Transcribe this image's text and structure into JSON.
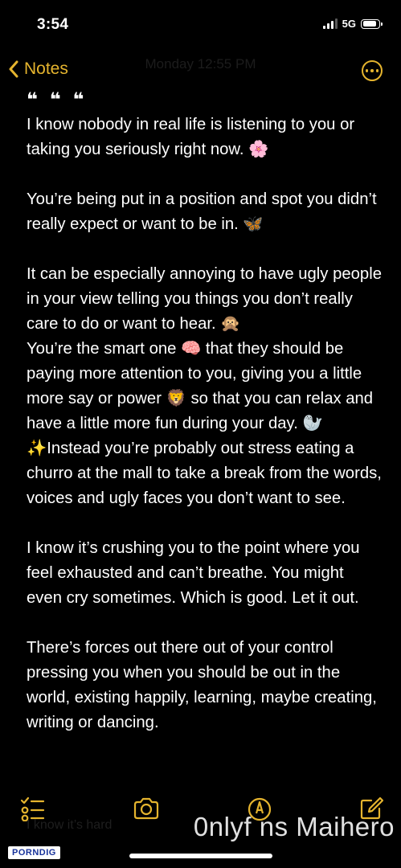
{
  "status_bar": {
    "time": "3:54",
    "network": "5G"
  },
  "nav": {
    "back_label": "Notes",
    "faded_title": "Monday 12:55 PM"
  },
  "note": {
    "opening": "❝ ❝ ❝",
    "paragraphs": [
      "I know nobody in real life is listening to you or taking you seriously right now. 🌸",
      "You’re being put in a position and spot you didn’t really expect or want to be in. 🦋",
      "It can be especially annoying to have ugly people in your view telling you things you don’t really care to do or want to hear. 🙊\nYou’re the smart one 🧠 that they should be paying more attention to you, giving you a little more say or power 🦁 so that you can relax and have a little more fun during your day. 🦭 ✨Instead you’re probably out stress eating a churro at the mall to take a break from the words, voices and ugly faces you don’t want to see.",
      "I know it’s crushing you to the point where you feel exhausted and can’t breathe. You might even cry sometimes. Which is good. Let it out.",
      "There’s forces out there out of your control pressing you when you should be out in the world, existing happily, learning, maybe creating, writing or dancing."
    ]
  },
  "toolbar": {
    "icons": [
      "checklist-icon",
      "camera-icon",
      "markup-icon",
      "compose-icon"
    ],
    "faded_text": "I know it’s hard"
  },
  "watermarks": {
    "right": "0nlyf ns Maihero",
    "left": "PORNDIG"
  },
  "colors": {
    "accent": "#e5b42e",
    "background": "#000000",
    "text": "#ffffff"
  }
}
